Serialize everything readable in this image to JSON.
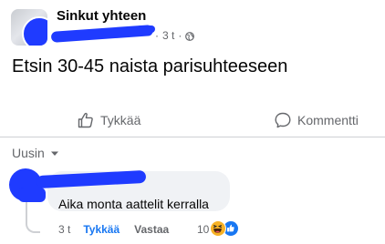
{
  "post": {
    "group_name": "Sinkut yhteen",
    "time": "3 t",
    "separator": "·",
    "privacy_icon": "globe-icon",
    "text": "Etsin 30-45 naista parisuhteeseen"
  },
  "actions": {
    "like_label": "Tykkää",
    "like_icon": "thumbs-up-icon",
    "comment_label": "Kommentti",
    "comment_icon": "speech-bubble-icon"
  },
  "comments_sort": {
    "label": "Uusin"
  },
  "comment": {
    "text": "Aika monta aattelit kerralla",
    "time": "3 t",
    "like_label": "Tykkää",
    "reply_label": "Vastaa",
    "reaction_count": "10",
    "reaction_icons": [
      "haha-icon",
      "like-icon"
    ]
  },
  "colors": {
    "accent": "#1877f2",
    "secondary_text": "#65676b",
    "bubble": "#f0f2f5",
    "redaction": "#1f3bff"
  }
}
